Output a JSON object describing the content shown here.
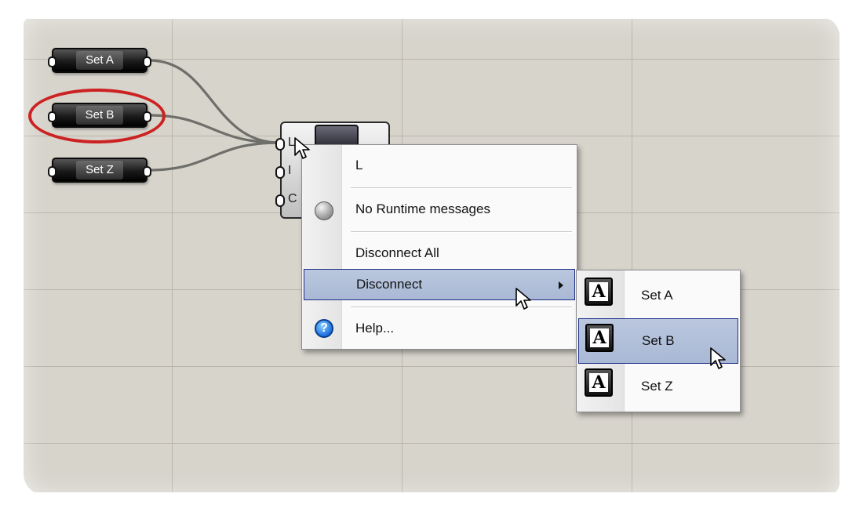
{
  "params": [
    {
      "name": "param-set-a",
      "label": "Set A"
    },
    {
      "name": "param-set-b",
      "label": "Set B"
    },
    {
      "name": "param-set-z",
      "label": "Set Z"
    }
  ],
  "component": {
    "inputs": [
      "L",
      "I",
      "C"
    ]
  },
  "context_menu": {
    "title": "L",
    "runtime": "No Runtime messages",
    "disconnect_all": "Disconnect All",
    "disconnect": "Disconnect",
    "help": "Help..."
  },
  "submenu": {
    "items": [
      {
        "icon": "A",
        "label": "Set A"
      },
      {
        "icon": "A",
        "label": "Set B"
      },
      {
        "icon": "A",
        "label": "Set Z"
      }
    ]
  },
  "colors": {
    "canvas": "#d7d4cc",
    "highlight_ring": "#cc2222",
    "menu_highlight": "#b3c0da"
  }
}
